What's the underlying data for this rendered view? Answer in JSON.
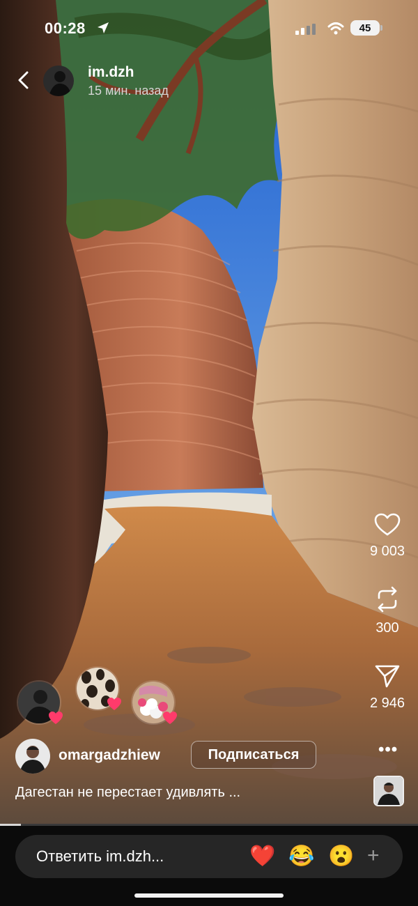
{
  "status_bar": {
    "time": "00:28",
    "battery": "45"
  },
  "story": {
    "username": "im.dzh",
    "time_ago": "15 мин. назад",
    "progress": 0.05
  },
  "actions": {
    "likes": "9 003",
    "reposts": "300",
    "shares": "2 946"
  },
  "post": {
    "author": "omargadzhiew",
    "follow_label": "Подписаться",
    "caption": "Дагестан не перестает удивлять ..."
  },
  "reply": {
    "placeholder": "Ответить im.dzh...",
    "quick_reactions": [
      "❤️",
      "😂",
      "😮"
    ],
    "add_label": "+"
  },
  "colors": {
    "like_badge": "#ff3b6b",
    "background": "#0b0b0b"
  },
  "icons": [
    "back-chevron-icon",
    "heart-icon",
    "repost-icon",
    "send-icon",
    "more-icon",
    "plus-icon",
    "location-arrow-icon",
    "wifi-icon",
    "signal-icon"
  ]
}
